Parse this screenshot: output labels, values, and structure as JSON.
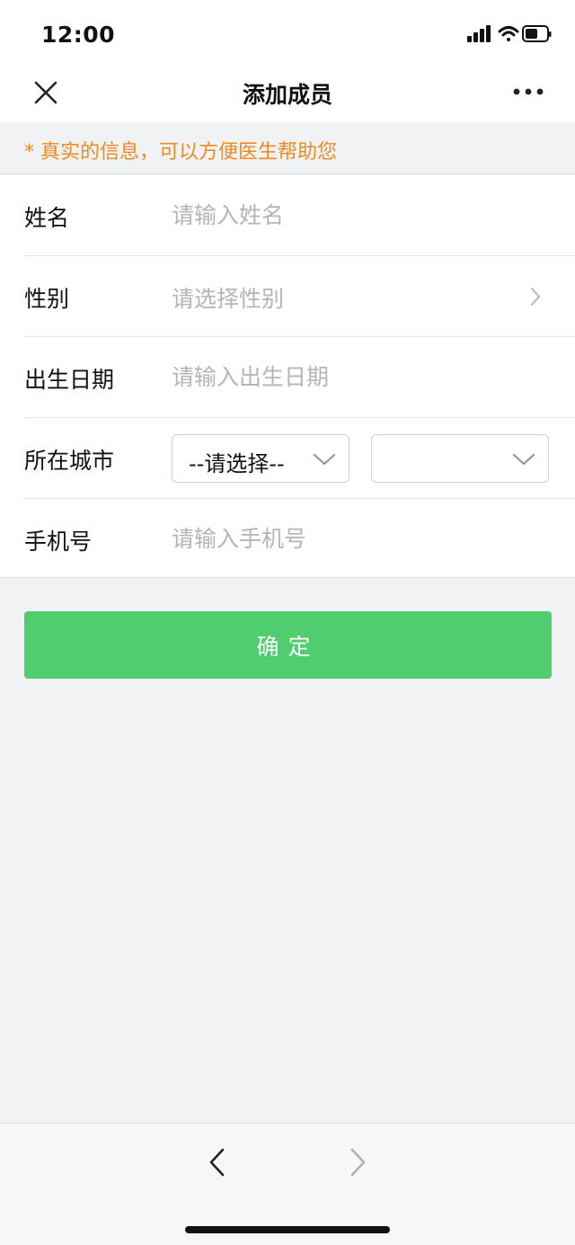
{
  "status_bar": {
    "time": "12:00",
    "icons": [
      "signal-icon",
      "wifi-icon",
      "battery-icon"
    ],
    "battery_level": 0.5
  },
  "nav": {
    "title": "添加成员",
    "close_icon": "close-icon",
    "more_icon": "more-icon"
  },
  "notice": {
    "text": "* 真实的信息，可以方便医生帮助您",
    "color": "#f08a1f"
  },
  "form": {
    "name": {
      "label": "姓名",
      "placeholder": "请输入姓名",
      "value": ""
    },
    "gender": {
      "label": "性别",
      "placeholder": "请选择性别"
    },
    "birthdate": {
      "label": "出生日期",
      "placeholder": "请输入出生日期",
      "value": ""
    },
    "city": {
      "label": "所在城市",
      "province_selected": "--请选择--",
      "city_selected": ""
    },
    "phone": {
      "label": "手机号",
      "placeholder": "请输入手机号",
      "value": ""
    }
  },
  "confirm": {
    "label": "确定",
    "color": "#4fcd6f"
  },
  "bottom_nav": {
    "back_icon": "chevron-left-icon",
    "forward_icon": "chevron-right-icon"
  }
}
